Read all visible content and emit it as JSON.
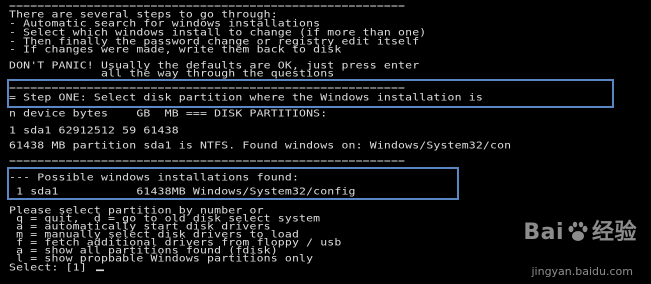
{
  "terminal": {
    "lines": [
      "========================================================",
      "There are several steps to go through:",
      "- Automatic search for windows installations",
      "- Select which windows install to change (if more than one)",
      "- Then finally the password change or registry edit itself",
      "- If changes were made, write them back to disk",
      "",
      "DON'T PANIC! Usually the defaults are OK, just press enter",
      "             all the way through the questions",
      "",
      "========================================================",
      "= Step ONE: Select disk partition where the Windows installation is",
      "",
      "n device bytes    GB  MB === DISK PARTITIONS:",
      "",
      "1 sda1 62912512 59 61438",
      "",
      "61438 MB partition sda1 is NTFS. Found windows on: Windows/System32/con",
      "",
      "========================================================",
      "",
      "--- Possible windows installations found:",
      "",
      " 1 sda1           61438MB Windows/System32/config",
      "",
      "Please select partition by number or",
      " q = quit,  d = go to old disk select system",
      " a = automatically start disk drivers",
      " m = manually select disk drivers to load",
      " f = fetch additional drivers from floppy / usb",
      " a = show all partitions found (fdisk)",
      " l = show propbable Windows partitions only",
      "Select: [1] "
    ]
  },
  "watermark": {
    "brand_left": "Bai",
    "brand_right": "经验",
    "url": "jingyan.baidu.com"
  },
  "colors": {
    "background": "#000000",
    "text": "#dcdcdc",
    "highlight_box": "#5b86c4"
  }
}
